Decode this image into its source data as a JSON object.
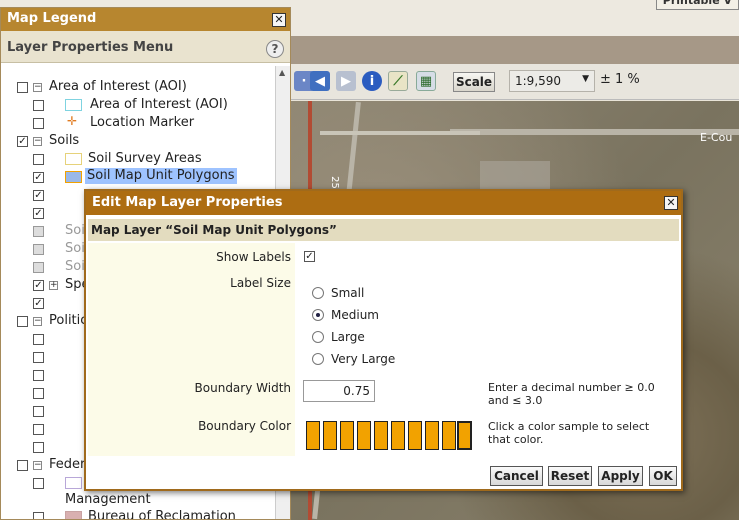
{
  "top": {
    "printable_label": "Printable V"
  },
  "toolbar": {
    "scale_label": "Scale",
    "scale_value": "1:9,590",
    "accuracy": "± 1 %",
    "road_label": "E-Cou",
    "road_number": "25"
  },
  "legend": {
    "title": "Map Legend",
    "menu_title": "Layer Properties Menu",
    "items": {
      "aoi_group": "Area of Interest (AOI)",
      "aoi": "Area of Interest (AOI)",
      "location_marker": "Location Marker",
      "soils_group": "Soils",
      "soil_survey_areas": "Soil Survey Areas",
      "soil_map_unit_polygons": "Soil Map Unit Polygons",
      "soi1": "Soi",
      "soi2": "Soi",
      "soi3": "Soi",
      "spe": "Spe",
      "political": "Politic",
      "federal": "Feder",
      "management": "Management",
      "bureau": "Bureau of Reclamation"
    }
  },
  "dialog": {
    "title": "Edit Map Layer Properties",
    "subtitle": "Map Layer “Soil Map Unit Polygons”",
    "show_labels": "Show Labels",
    "label_size": "Label Size",
    "sizes": [
      "Small",
      "Medium",
      "Large",
      "Very Large"
    ],
    "selected_size": "Medium",
    "boundary_width_label": "Boundary Width",
    "boundary_width_value": "0.75",
    "boundary_width_hint": "Enter a decimal number ≥ 0.0 and ≤ 3.0",
    "boundary_color_label": "Boundary Color",
    "boundary_color_hint": "Click a color sample to select that color.",
    "color": "#f2a200",
    "buttons": {
      "cancel": "Cancel",
      "reset": "Reset",
      "apply": "Apply",
      "ok": "OK"
    }
  }
}
